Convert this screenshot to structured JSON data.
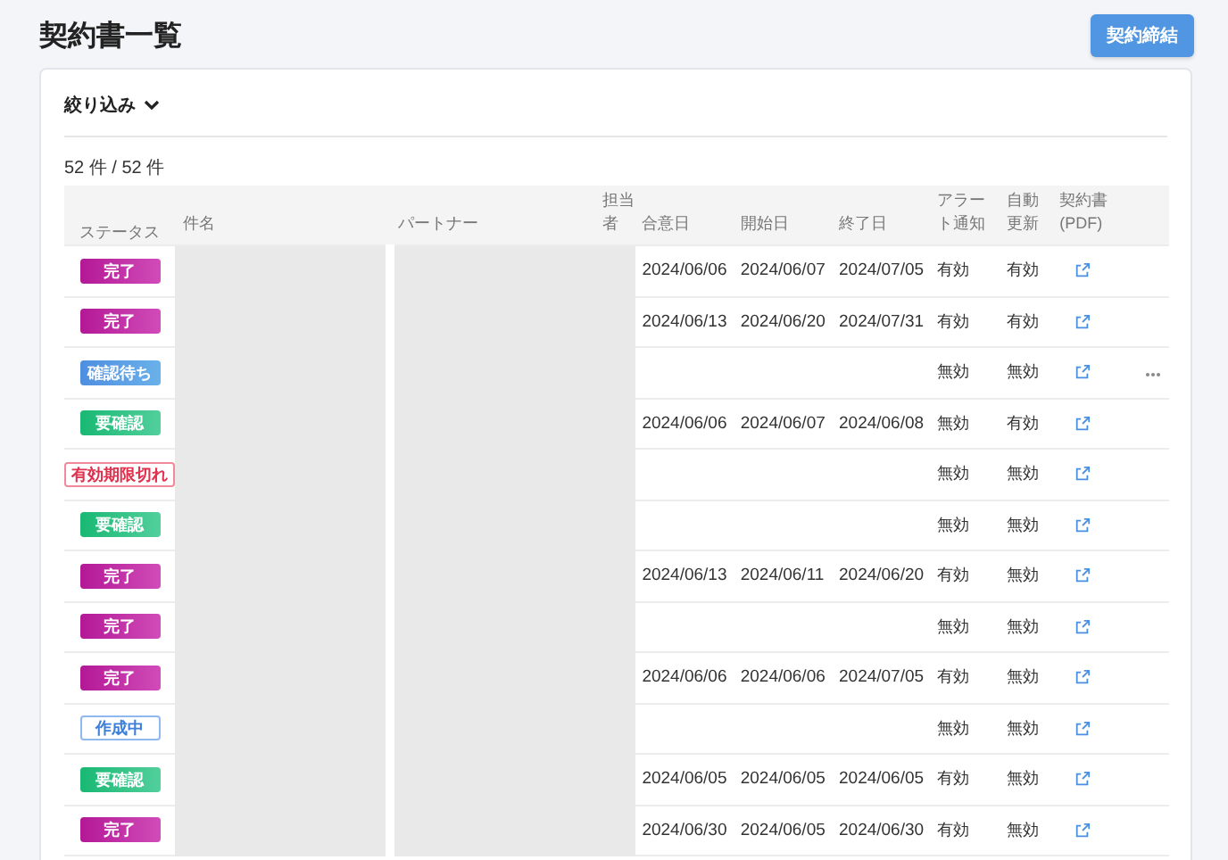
{
  "page_title": "契約書一覧",
  "primary_button": "契約締結",
  "filter": {
    "label": "絞り込み",
    "expanded": false
  },
  "count": "52 件 / 52 件",
  "table": {
    "columns": [
      "ステータス",
      "件名",
      "パートナー",
      "担当者",
      "合意日",
      "開始日",
      "終了日",
      "アラート通知",
      "自動更新",
      "契約書 (PDF)"
    ],
    "rows": [
      {
        "status": "完了",
        "kind": "done",
        "agreed": "2024/06/06",
        "start": "2024/06/07",
        "end": "2024/07/05",
        "alert": "有効",
        "auto": "有効",
        "more_menu": false
      },
      {
        "status": "完了",
        "kind": "done",
        "agreed": "2024/06/13",
        "start": "2024/06/20",
        "end": "2024/07/31",
        "alert": "有効",
        "auto": "有効",
        "more_menu": false
      },
      {
        "status": "確認待ち",
        "kind": "waiting",
        "alert": "無効",
        "auto": "無効",
        "more_menu": true
      },
      {
        "status": "要確認",
        "kind": "review",
        "agreed": "2024/06/06",
        "start": "2024/06/07",
        "end": "2024/06/08",
        "alert": "無効",
        "auto": "有効",
        "more_menu": false
      },
      {
        "status": "有効期限切れ",
        "kind": "expired",
        "alert": "無効",
        "auto": "無効",
        "more_menu": false
      },
      {
        "status": "要確認",
        "kind": "review",
        "alert": "無効",
        "auto": "無効",
        "more_menu": false
      },
      {
        "status": "完了",
        "kind": "done",
        "agreed": "2024/06/13",
        "start": "2024/06/11",
        "end": "2024/06/20",
        "alert": "有効",
        "auto": "無効",
        "more_menu": false
      },
      {
        "status": "完了",
        "kind": "done",
        "alert": "無効",
        "auto": "無効",
        "more_menu": false
      },
      {
        "status": "完了",
        "kind": "done",
        "agreed": "2024/06/06",
        "start": "2024/06/06",
        "end": "2024/07/05",
        "alert": "有効",
        "auto": "無効",
        "more_menu": false
      },
      {
        "status": "作成中",
        "kind": "draft",
        "alert": "無効",
        "auto": "無効",
        "more_menu": false
      },
      {
        "status": "要確認",
        "kind": "review",
        "agreed": "2024/06/05",
        "start": "2024/06/05",
        "end": "2024/06/05",
        "alert": "有効",
        "auto": "無効",
        "more_menu": false
      },
      {
        "status": "完了",
        "kind": "done",
        "agreed": "2024/06/30",
        "start": "2024/06/05",
        "end": "2024/06/30",
        "alert": "有効",
        "auto": "無効",
        "more_menu": false
      }
    ]
  }
}
